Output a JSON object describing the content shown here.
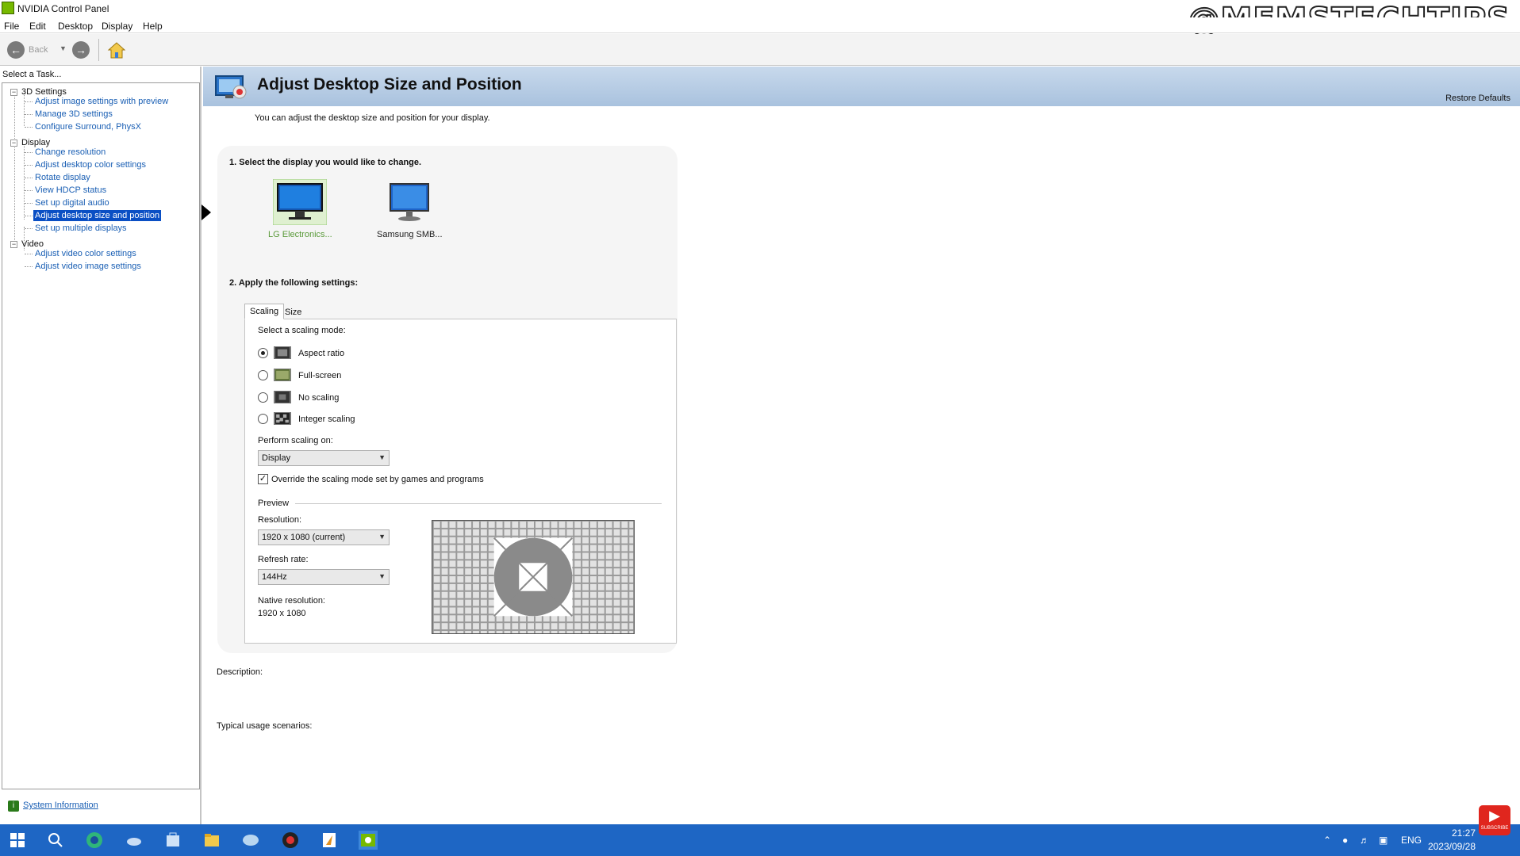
{
  "window": {
    "title": "NVIDIA Control Panel",
    "watermark": "@MEMSTECHTIPS"
  },
  "menu": [
    "File",
    "Edit",
    "Desktop",
    "Display",
    "Help"
  ],
  "toolbar": {
    "back_label": "Back"
  },
  "left_pane": {
    "task_label": "Select a Task...",
    "groups": [
      {
        "label": "3D Settings",
        "items": [
          "Adjust image settings with preview",
          "Manage 3D settings",
          "Configure Surround, PhysX"
        ]
      },
      {
        "label": "Display",
        "items": [
          "Change resolution",
          "Adjust desktop color settings",
          "Rotate display",
          "View HDCP status",
          "Set up digital audio",
          "Adjust desktop size and position",
          "Set up multiple displays"
        ]
      },
      {
        "label": "Video",
        "items": [
          "Adjust video color settings",
          "Adjust video image settings"
        ]
      }
    ],
    "selected_item": "Adjust desktop size and position",
    "system_information": "System Information"
  },
  "header": {
    "title": "Adjust Desktop Size and Position",
    "restore_defaults": "Restore Defaults"
  },
  "intro": "You can adjust the desktop size and position for your display.",
  "step1": {
    "heading": "1. Select the display you would like to change.",
    "displays": [
      {
        "label": "LG Electronics...",
        "selected": true
      },
      {
        "label": "Samsung SMB...",
        "selected": false
      }
    ]
  },
  "step2": {
    "heading": "2. Apply the following settings:",
    "tabs": [
      "Scaling",
      "Size"
    ],
    "active_tab": "Scaling",
    "scaling_mode_label": "Select a scaling mode:",
    "modes": [
      {
        "label": "Aspect ratio",
        "selected": true
      },
      {
        "label": "Full-screen",
        "selected": false
      },
      {
        "label": "No scaling",
        "selected": false
      },
      {
        "label": "Integer scaling",
        "selected": false
      }
    ],
    "perform_scaling_label": "Perform scaling on:",
    "perform_scaling_value": "Display",
    "override_label": "Override the scaling mode set by games and programs",
    "override_checked": true,
    "preview_label": "Preview",
    "resolution_label": "Resolution:",
    "resolution_value": "1920 x 1080 (current)",
    "refresh_label": "Refresh rate:",
    "refresh_value": "144Hz",
    "native_label": "Native resolution:",
    "native_value": "1920 x 1080"
  },
  "description_label": "Description:",
  "usage_label": "Typical usage scenarios:",
  "taskbar": {
    "language": "ENG",
    "time": "21:27",
    "date": "2023/09/28",
    "subscribe": "SUBSCRIBE"
  },
  "colors": {
    "accent": "#76b900",
    "selection": "#0a4fc4",
    "taskbar": "#1e66c4",
    "link": "#1a5fb4"
  }
}
